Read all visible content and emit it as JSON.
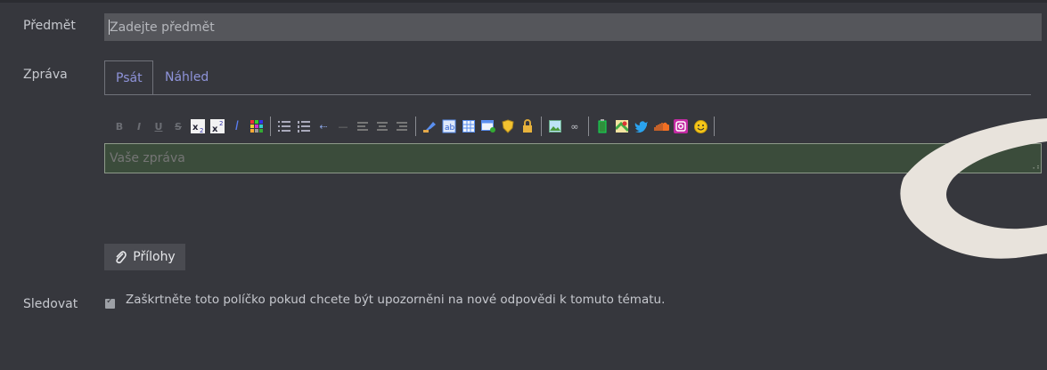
{
  "form": {
    "subject_label": "Předmět",
    "subject_placeholder": "Zadejte předmět",
    "message_label": "Zpráva",
    "watch_label": "Sledovat",
    "watch_text": "Zaškrtněte toto políčko pokud chcete být upozorněni na nové odpovědi k tomuto tématu."
  },
  "tabs": {
    "write": "Psát",
    "preview": "Náhled"
  },
  "editor": {
    "placeholder": "Vaše zpráva",
    "toolbar_icons": [
      "bold-icon",
      "italic-icon",
      "underline-icon",
      "strikethrough-icon",
      "subscript-icon",
      "superscript-icon",
      "remove-format-icon",
      "color-grid-icon",
      "bullet-list-icon",
      "numbered-list-icon",
      "outdent-icon",
      "indent-icon",
      "align-left-icon",
      "align-center-icon",
      "align-right-icon",
      "quote-icon",
      "code-icon",
      "table-icon",
      "insert-template-icon",
      "shield-icon",
      "lock-icon",
      "image-icon",
      "link-icon",
      "battery-icon",
      "map-icon",
      "twitter-icon",
      "soundcloud-icon",
      "instagram-icon",
      "smiley-icon"
    ]
  },
  "attachments": {
    "label": "Přílohy"
  },
  "colors": {
    "background": "#36373d",
    "accent": "#8e93d9",
    "editor_bg": "#3b4c3b"
  }
}
